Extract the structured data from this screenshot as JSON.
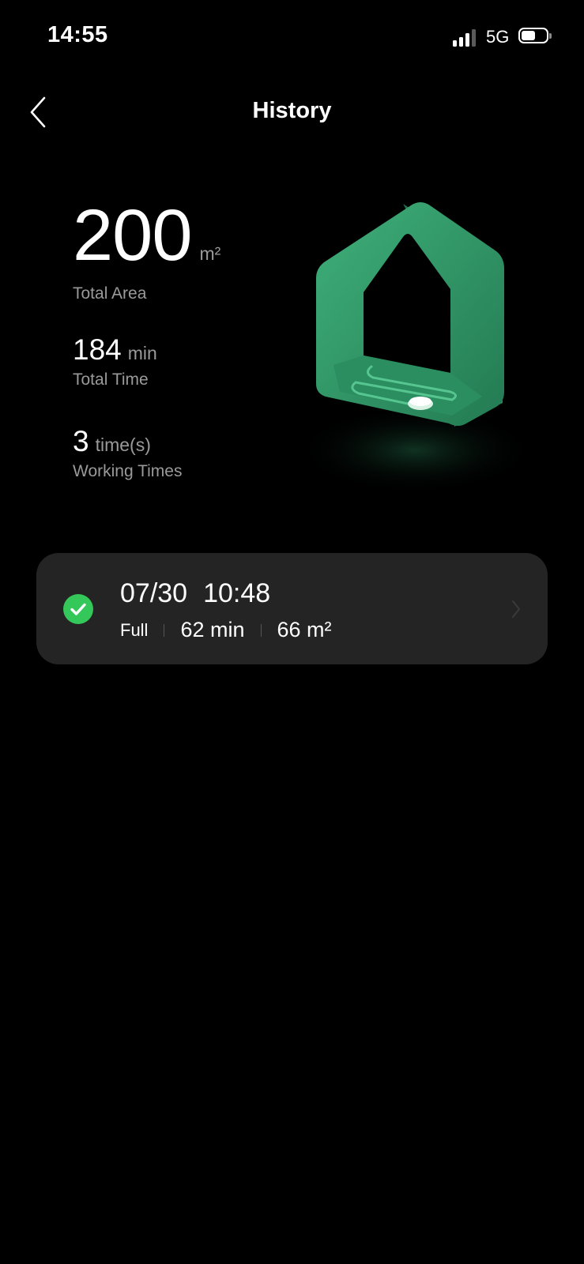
{
  "status_bar": {
    "time": "14:55",
    "network": "5G",
    "icons": [
      "signal-icon",
      "battery-icon"
    ]
  },
  "header": {
    "title": "History",
    "back_icon": "chevron-left-icon"
  },
  "stats": {
    "total_area": {
      "value": "200",
      "unit": "m²",
      "label": "Total Area"
    },
    "total_time": {
      "value": "184",
      "unit": "min",
      "label": "Total Time"
    },
    "working_times": {
      "value": "3",
      "unit": "time(s)",
      "label": "Working Times"
    }
  },
  "illustration": {
    "icon": "house-icon",
    "color": "#2f9e6a"
  },
  "history": [
    {
      "date": "07/30",
      "time": "10:48",
      "mode": "Full",
      "duration": "62 min",
      "area": "66 m²",
      "status_icon": "check-circle-icon",
      "status_color": "#34c759"
    }
  ],
  "colors": {
    "background": "#000000",
    "card": "#242424",
    "secondary_text": "#9a9a9a",
    "accent": "#34c759"
  }
}
